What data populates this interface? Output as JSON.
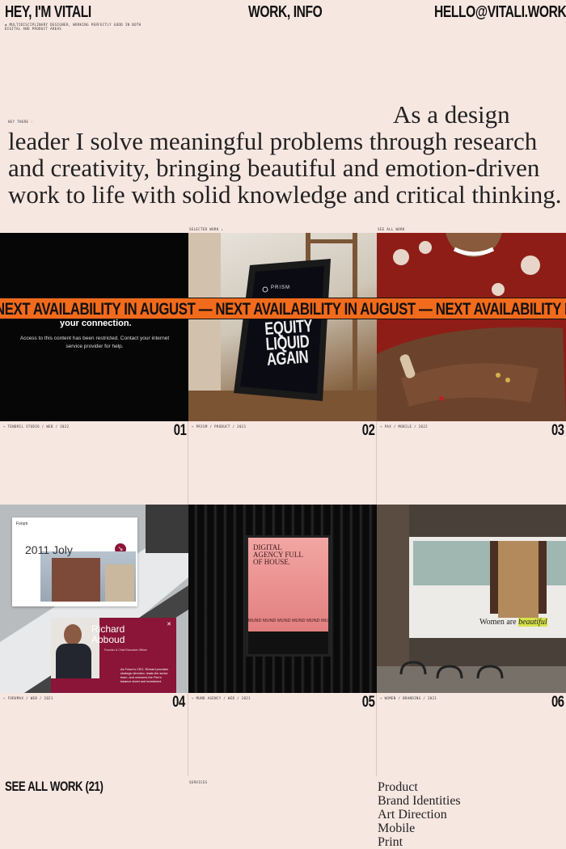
{
  "header": {
    "name": "HEY, I'M VITALI",
    "nav": "WORK, INFO",
    "email": "HELLO@VITALI.WORK",
    "tagline": "✱ MULTIDISCIPLINARY DESIGNER, WORKING PERFECTLY GOOD IN BOTH DIGITAL AND PRODUCT AREAS"
  },
  "intro": {
    "eyebrow": "HEY THERE",
    "eyebrow_icon": "sun-icon",
    "text": "As a design leader I solve meaningful problems through research and creativity, bringing beautiful and emotion-driven work to life with solid knowledge and critical thinking."
  },
  "labels": {
    "selected_work": "SELECTED WORK ↓",
    "see_all_top": "SEE ALL WORK"
  },
  "ticker": {
    "text": "NEXT AVAILABILITY IN AUGUST — NEXT AVAILABILITY IN AUGUST — NEXT AVAILABILITY IN AUGUST"
  },
  "projects": [
    {
      "num": "01",
      "caption": "→ TENDRIL STUDIO / WEB / 2022",
      "restricted_title": "your connection.",
      "restricted_msg": "Access to this content has been restricted. Contact your internet service provider for help."
    },
    {
      "num": "02",
      "caption": "→ PRISM / PRODUCT / 2021",
      "brand": "PRISM",
      "poster_text": "MAKE EQUITY LIQUID AGAIN"
    },
    {
      "num": "03",
      "caption": "→ PAX / MOBILE / 2022"
    },
    {
      "num": "04",
      "caption": "→ FORUMAX / WEB / 2021",
      "brand": "Forum",
      "event": "2011 Joly",
      "person": "Richard Abboud",
      "role": "Founder & Chief Executive Officer",
      "bio": "As Forum's CEO, Richard provides strategic direction, leads the senior team, and oversees the Firm's balance sheet and investment"
    },
    {
      "num": "05",
      "caption": "→ MUND AGENCY / WEB / 2021",
      "poster_title": "DIGITAL AGENCY FULL OF HOUSE.",
      "poster_strip": "MUND MUND MUND MUND MUND MUND"
    },
    {
      "num": "06",
      "caption": "→ WOMEN / BRANDING / 2021",
      "billboard_a": "Women are",
      "billboard_b": "beautiful"
    }
  ],
  "footer": {
    "see_all": "SEE ALL WORK (21)",
    "services_label": "SERVICES",
    "services": [
      "Product",
      "Brand Identities",
      "Art Direction",
      "Mobile",
      "Print"
    ]
  },
  "colors": {
    "background": "#f7e7e1",
    "accent": "#f26a1b",
    "burgundy": "#8a1538"
  }
}
